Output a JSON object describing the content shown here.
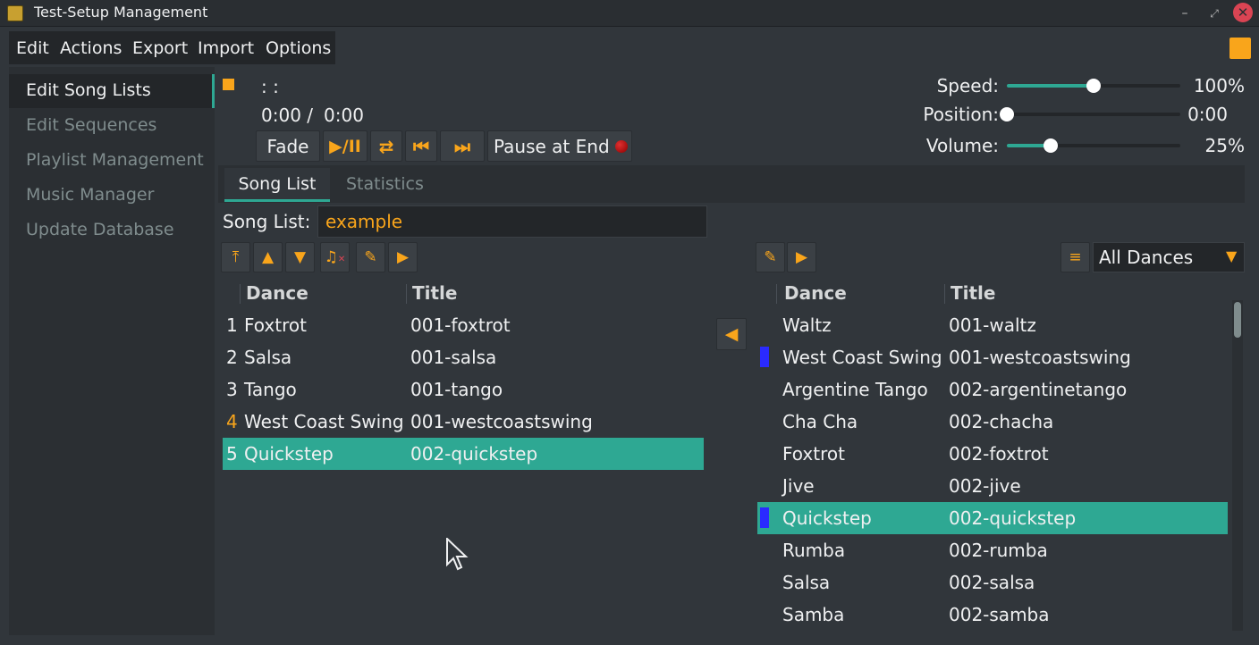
{
  "window": {
    "title": "Test-Setup Management",
    "minimize": "–",
    "maximize": "⤢",
    "close": "✕"
  },
  "menu": [
    "Edit",
    "Actions",
    "Export",
    "Import",
    "Options"
  ],
  "sidebar": [
    "Edit Song Lists",
    "Edit Sequences",
    "Playlist Management",
    "Music Manager",
    "Update Database"
  ],
  "player": {
    "track_text": ": :",
    "time_current": "0:00 /",
    "time_total": "0:00",
    "fade_label": "Fade",
    "playpause_label": "▶/II",
    "loop_icon": "⇄",
    "prev_icon": "⏮",
    "next_icon": "⏭",
    "pause_end_label": "Pause at End",
    "speed_label": "Speed:",
    "speed_value": "100%",
    "speed_level": 0.5,
    "position_label": "Position:",
    "position_value": "0:00",
    "position_level": 0.0,
    "volume_label": "Volume:",
    "volume_value": "25%",
    "volume_level": 0.25
  },
  "tabs": [
    "Song List",
    "Statistics"
  ],
  "song_list": {
    "label": "Song List:",
    "value": "example"
  },
  "dance_filter": {
    "value": "All Dances"
  },
  "left_table": {
    "headers": [
      "Dance",
      "Title"
    ],
    "rows": [
      {
        "num": "1",
        "dance": "Foxtrot",
        "title": "001-foxtrot"
      },
      {
        "num": "2",
        "dance": "Salsa",
        "title": "001-salsa"
      },
      {
        "num": "3",
        "dance": "Tango",
        "title": "001-tango"
      },
      {
        "num": "4",
        "dance": "West Coast Swing",
        "title": "001-westcoastswing"
      },
      {
        "num": "5",
        "dance": "Quickstep",
        "title": "002-quickstep"
      }
    ]
  },
  "right_table": {
    "headers": [
      "Dance",
      "Title"
    ],
    "rows": [
      {
        "dance": "Waltz",
        "title": "001-waltz"
      },
      {
        "dance": "West Coast Swing",
        "title": "001-westcoastswing"
      },
      {
        "dance": "Argentine Tango",
        "title": "002-argentinetango"
      },
      {
        "dance": "Cha Cha",
        "title": "002-chacha"
      },
      {
        "dance": "Foxtrot",
        "title": "002-foxtrot"
      },
      {
        "dance": "Jive",
        "title": "002-jive"
      },
      {
        "dance": "Quickstep",
        "title": "002-quickstep"
      },
      {
        "dance": "Rumba",
        "title": "002-rumba"
      },
      {
        "dance": "Salsa",
        "title": "002-salsa"
      },
      {
        "dance": "Samba",
        "title": "002-samba"
      }
    ]
  },
  "icons": {
    "move_top": "move-top-icon",
    "up": "arrow-up-icon",
    "down": "arrow-down-icon",
    "remove": "remove-song-icon",
    "edit": "pencil-icon",
    "play": "play-icon",
    "add": "arrow-left-icon",
    "filter": "filter-icon"
  },
  "colors": {
    "accent": "#2ea893",
    "orange": "#f9a51b",
    "marker": "#2a2aff",
    "record": "#8b0000"
  }
}
